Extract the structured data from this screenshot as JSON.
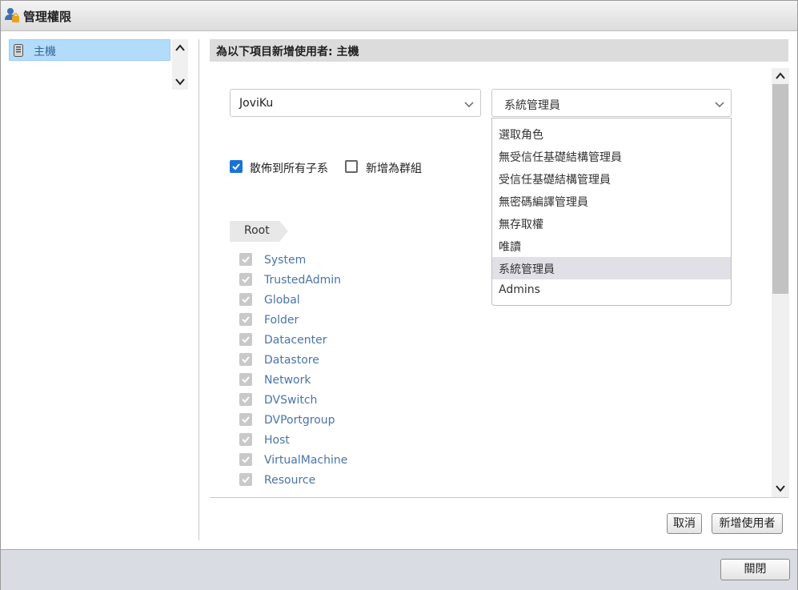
{
  "window": {
    "title": "管理權限"
  },
  "sidebar": {
    "items": [
      {
        "label": "主機"
      }
    ]
  },
  "header": {
    "title": "為以下項目新增使用者: 主機"
  },
  "form": {
    "user_value": "JoviKu",
    "role_value": "系統管理員",
    "role_options": [
      "選取角色",
      "無受信任基礎結構管理員",
      "受信任基礎結構管理員",
      "無密碼編譯管理員",
      "無存取權",
      "唯讀",
      "系統管理員",
      "Admins"
    ],
    "role_selected_index": 6,
    "propagate": {
      "label": "散佈到所有子系",
      "checked": true
    },
    "add_as_group": {
      "label": "新增為群組",
      "checked": false
    }
  },
  "breadcrumb": {
    "label": "Root"
  },
  "privileges": [
    "System",
    "TrustedAdmin",
    "Global",
    "Folder",
    "Datacenter",
    "Datastore",
    "Network",
    "DVSwitch",
    "DVPortgroup",
    "Host",
    "VirtualMachine",
    "Resource"
  ],
  "buttons": {
    "cancel": "取消",
    "add_user": "新增使用者",
    "close": "關閉"
  },
  "colors": {
    "accent": "#1a73d6",
    "nav_selected": "#b3dcfb",
    "link": "#4a74a8"
  }
}
